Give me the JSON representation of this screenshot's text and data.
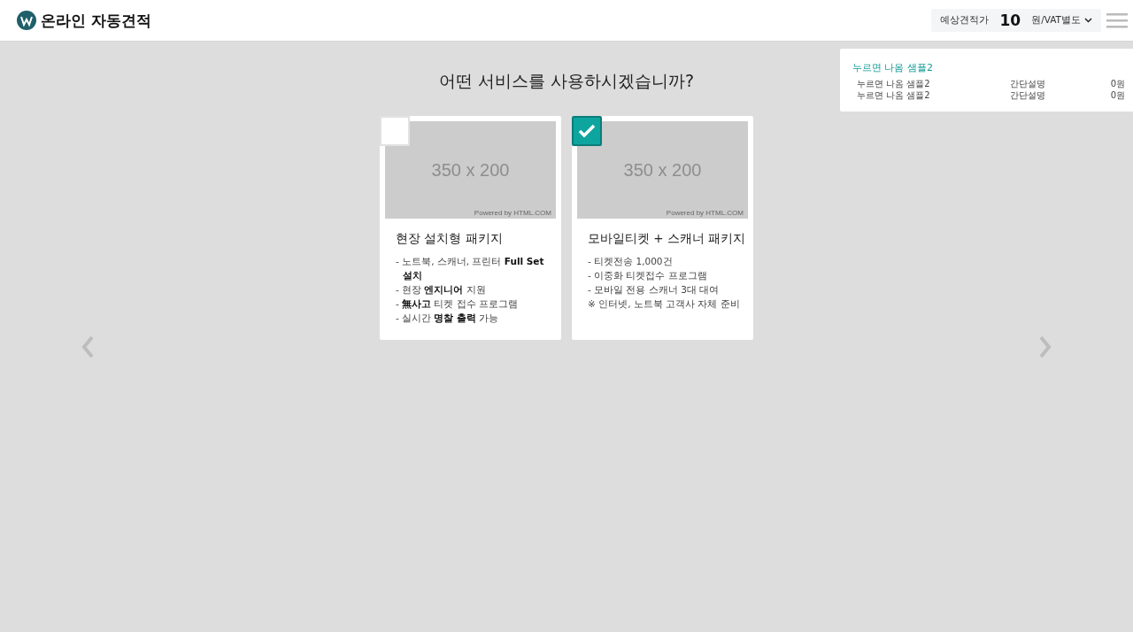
{
  "header": {
    "title": "온라인 자동견적",
    "estimate": {
      "label": "예상견적가",
      "amount": "10",
      "unit": "원/VAT별도"
    }
  },
  "summary_panel": {
    "title": "누르면 나옴 샘플2",
    "rows": [
      {
        "name": "누르면 나옴 샘플2",
        "description": "간단설명",
        "price": "0원"
      },
      {
        "name": "누르면 나옴 샘플2",
        "description": "간단설명",
        "price": "0원"
      }
    ]
  },
  "question": "어떤 서비스를 사용하시겠습니까?",
  "cards": [
    {
      "selected": false,
      "image_label": "350 x 200",
      "image_credit": "Powered by HTML.COM",
      "title": "현장 설치형 패키지",
      "lines": [
        "- 노트북, 스캐너, 프린터 **Full Set 설치**",
        "- 현장 **엔지니어** 지원",
        "- **無사고** 티켓 접수 프로그램",
        "- 실시간 **명찰 출력** 가능"
      ]
    },
    {
      "selected": true,
      "image_label": "350 x 200",
      "image_credit": "Powered by HTML.COM",
      "title": "모바일티켓 + 스캐너 패키지",
      "lines": [
        "- 티켓전송 1,000건",
        "- 이중화 티켓접수 프로그램",
        "- 모바일 전용 스캐너 3대 대여",
        "※ 인터넷, 노트북 고객사 자체 준비"
      ]
    }
  ]
}
